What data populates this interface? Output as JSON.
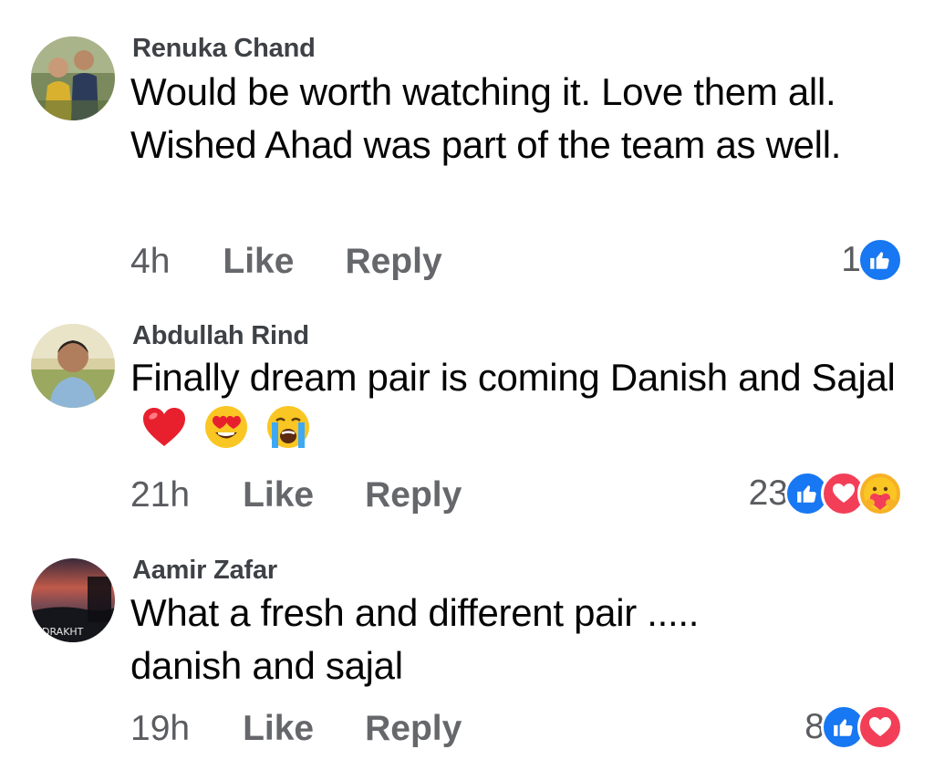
{
  "comments": [
    {
      "author": "Renuka Chand",
      "text": "Would be worth watching it. Love them all. Wished Ahad was part of the team as well.",
      "time": "4h",
      "like_label": "Like",
      "reply_label": "Reply",
      "reaction_count": "1",
      "reactions": [
        "like-icon"
      ],
      "emojis": []
    },
    {
      "author": "Abdullah Rind",
      "text": "Finally dream pair is coming Danish and Sajal",
      "time": "21h",
      "like_label": "Like",
      "reply_label": "Reply",
      "reaction_count": "23",
      "reactions": [
        "like-icon",
        "love-icon",
        "care-icon"
      ],
      "emojis": [
        "red-heart-emoji",
        "heart-eyes-emoji",
        "loudly-crying-emoji"
      ]
    },
    {
      "author": "Aamir Zafar",
      "text": "What a fresh and different pair ..... danish and sajal",
      "time": "19h",
      "like_label": "Like",
      "reply_label": "Reply",
      "reaction_count": "8",
      "reactions": [
        "like-icon",
        "love-icon"
      ],
      "emojis": [],
      "avatar_caption": "DRAKHT"
    }
  ],
  "colors": {
    "like": "#1877f2",
    "love": "#f33e58",
    "care": "#f7b125",
    "action_text": "#65676b",
    "author_text": "#3e4145"
  }
}
